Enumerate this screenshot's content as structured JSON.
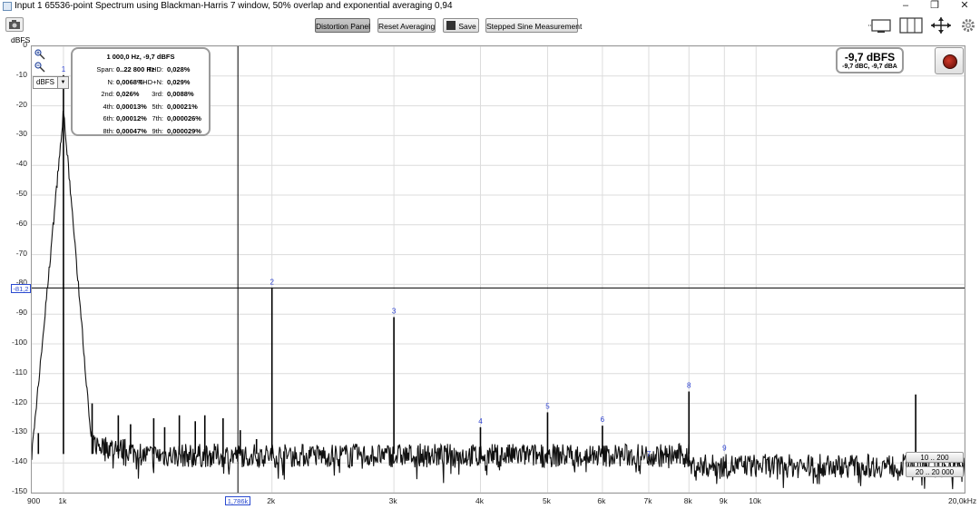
{
  "window": {
    "title": "Input 1 65536-point Spectrum using Blackman-Harris 7 window, 50% overlap and exponential averaging 0,94",
    "minimize": "–",
    "restore": "❐",
    "close": "✕"
  },
  "toolbar": {
    "distortion_panel": "Distortion Panel",
    "reset_averaging": "Reset Averaging",
    "save": "Save",
    "stepped_sine": "Stepped Sine Measurement"
  },
  "icons": {
    "capture": "camera-icon",
    "save": "save-icon",
    "layout1": "layout-single-icon",
    "layout2": "layout-columns-icon",
    "expand": "expand-arrows-icon",
    "settings": "gear-icon",
    "record": "record-icon",
    "zoom_in": "zoom-in-icon",
    "zoom_out": "zoom-out-icon"
  },
  "unit_label": "dBFS",
  "unit_select": "dBFS",
  "info": {
    "header": "1 000,0 Hz, -9,7 dBFS",
    "rows": [
      {
        "l1": "Span:",
        "v1": "0..22 800 Hz",
        "l2": "THD:",
        "v2": "0,028%"
      },
      {
        "l1": "N:",
        "v1": "0,0068%",
        "l2": "THD+N:",
        "v2": "0,029%"
      },
      {
        "l1": "2nd:",
        "v1": "0,026%",
        "l2": "3rd:",
        "v2": "0,0088%"
      },
      {
        "l1": "4th:",
        "v1": "0,00013%",
        "l2": "5th:",
        "v2": "0,00021%"
      },
      {
        "l1": "6th:",
        "v1": "0,00012%",
        "l2": "7th:",
        "v2": "0,000026%"
      },
      {
        "l1": "8th:",
        "v1": "0,00047%",
        "l2": "9th:",
        "v2": "0,000029%"
      }
    ]
  },
  "level": {
    "main": "-9,7 dBFS",
    "sub": "-9,7 dBC, -9,7 dBA"
  },
  "cursor": {
    "y_value": "-81,2",
    "x_value": "1,786k"
  },
  "range_buttons": {
    "y_range": "10 .. 200",
    "x_range": "20 .. 20 000"
  },
  "chart_data": {
    "type": "line",
    "xscale": "log",
    "xlim": [
      900,
      20000
    ],
    "ylim": [
      -150,
      0
    ],
    "ylabel": "dBFS",
    "yticks": [
      "0",
      "-10",
      "-20",
      "-30",
      "-40",
      "-50",
      "-60",
      "-70",
      "-80",
      "-90",
      "-100",
      "-110",
      "-120",
      "-130",
      "-140",
      "-150"
    ],
    "xticks": [
      "900",
      "1k",
      "2k",
      "3k",
      "4k",
      "5k",
      "6k",
      "7k",
      "8k",
      "9k",
      "10k",
      "20,0kHz"
    ],
    "grid": true,
    "harmonics": [
      {
        "label": "1",
        "freq": 1000,
        "level": -9.7
      },
      {
        "label": "2",
        "freq": 2000,
        "level": -81.2
      },
      {
        "label": "3",
        "freq": 3000,
        "level": -91
      },
      {
        "label": "4",
        "freq": 4000,
        "level": -128
      },
      {
        "label": "5",
        "freq": 5000,
        "level": -123
      },
      {
        "label": "6",
        "freq": 6000,
        "level": -127.5
      },
      {
        "label": "7",
        "freq": 7000,
        "level": -139
      },
      {
        "label": "8",
        "freq": 8000,
        "level": -116
      },
      {
        "label": "9",
        "freq": 9000,
        "level": -137
      }
    ],
    "spurs": [
      {
        "freq": 920,
        "level": -130
      },
      {
        "freq": 1100,
        "level": -120
      },
      {
        "freq": 1200,
        "level": -124
      },
      {
        "freq": 1250,
        "level": -127
      },
      {
        "freq": 1350,
        "level": -125
      },
      {
        "freq": 1400,
        "level": -128
      },
      {
        "freq": 1470,
        "level": -124
      },
      {
        "freq": 1550,
        "level": -126
      },
      {
        "freq": 1600,
        "level": -124
      },
      {
        "freq": 1700,
        "level": -125
      },
      {
        "freq": 1800,
        "level": -129
      },
      {
        "freq": 1900,
        "level": -132
      },
      {
        "freq": 17000,
        "level": -117
      }
    ],
    "noise_floor": -140,
    "cursor_line": {
      "freq": 1786,
      "level": -81.2
    }
  }
}
